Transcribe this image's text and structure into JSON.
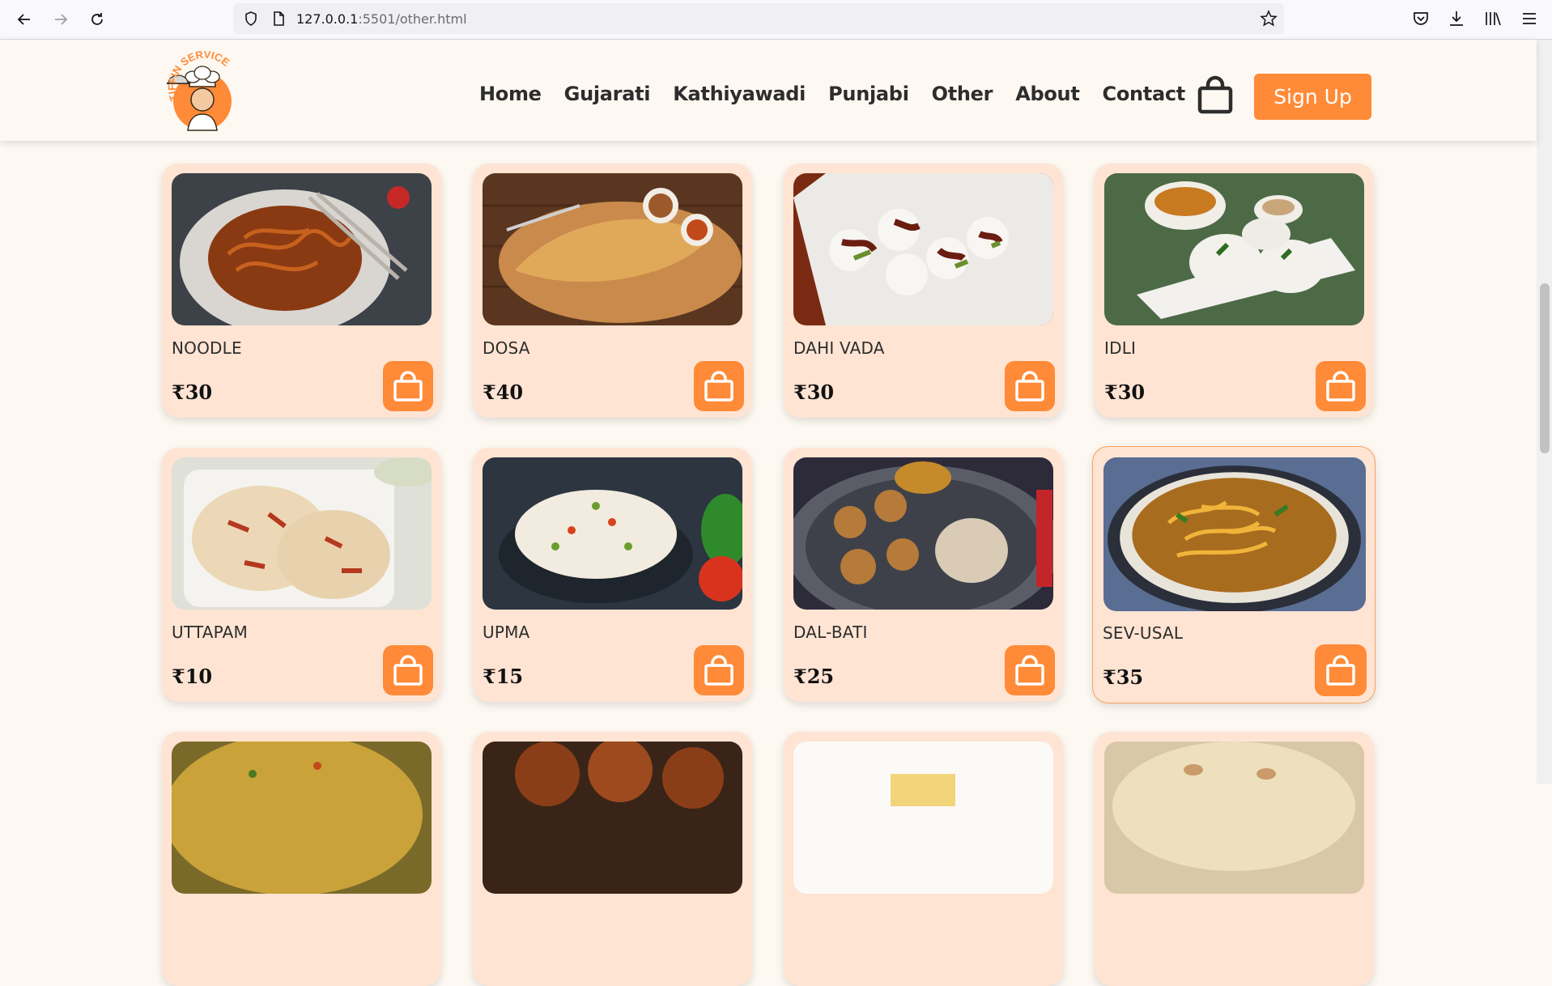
{
  "browser": {
    "url_host": "127.0.0.1",
    "url_rest": ":5501/other.html"
  },
  "site": {
    "logo_text": "TIFFIN SERVICE",
    "nav": [
      "Home",
      "Gujarati",
      "Kathiyawadi",
      "Punjabi",
      "Other",
      "About",
      "Contact"
    ],
    "signup_label": "Sign Up"
  },
  "colors": {
    "accent": "#ff8a37",
    "card_bg": "#ffe4d3",
    "page_bg": "#fdf8f2"
  },
  "items": [
    {
      "name": "NOODLE",
      "price": "₹30"
    },
    {
      "name": "DOSA",
      "price": "₹40"
    },
    {
      "name": "DAHI VADA",
      "price": "₹30"
    },
    {
      "name": "IDLI",
      "price": "₹30"
    },
    {
      "name": "UTTAPAM",
      "price": "₹10"
    },
    {
      "name": "UPMA",
      "price": "₹15"
    },
    {
      "name": "DAL-BATI",
      "price": "₹25"
    },
    {
      "name": "SEV-USAL",
      "price": "₹35"
    }
  ]
}
